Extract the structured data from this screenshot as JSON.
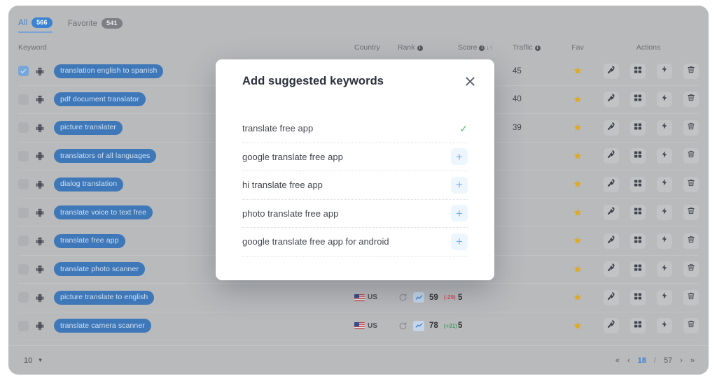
{
  "tabs": [
    {
      "label": "All",
      "count": "566",
      "active": true
    },
    {
      "label": "Favorite",
      "count": "541",
      "active": false
    }
  ],
  "table": {
    "headers": {
      "keyword": "Keyword",
      "country": "Country",
      "rank": "Rank",
      "score": "Score",
      "traffic": "Traffic",
      "fav": "Fav",
      "actions": "Actions"
    },
    "sort_icon": "sort-ascending-descending-icon",
    "rows": [
      {
        "checked": true,
        "keyword": "translation english to spanish",
        "country": "",
        "country_code": "",
        "rank": "",
        "rank_delta": "",
        "rank_delta_dir": "",
        "score": "",
        "traffic": "45",
        "fav": "★"
      },
      {
        "checked": false,
        "keyword": "pdf document translator",
        "country": "",
        "country_code": "",
        "rank": "",
        "rank_delta": "",
        "rank_delta_dir": "",
        "score": "",
        "traffic": "40",
        "fav": "★"
      },
      {
        "checked": false,
        "keyword": "picture translater",
        "country": "",
        "country_code": "",
        "rank": "",
        "rank_delta": "",
        "rank_delta_dir": "",
        "score": "",
        "traffic": "39",
        "fav": "★"
      },
      {
        "checked": false,
        "keyword": "translators of all languages",
        "country": "",
        "country_code": "",
        "rank": "",
        "rank_delta": "",
        "rank_delta_dir": "",
        "score": "",
        "traffic": "",
        "fav": "★"
      },
      {
        "checked": false,
        "keyword": "dialog translation",
        "country": "",
        "country_code": "",
        "rank": "",
        "rank_delta": "",
        "rank_delta_dir": "",
        "score": "",
        "traffic": "",
        "fav": "★"
      },
      {
        "checked": false,
        "keyword": "translate voice to text free",
        "country": "",
        "country_code": "",
        "rank": "",
        "rank_delta": "",
        "rank_delta_dir": "",
        "score": "",
        "traffic": "",
        "fav": "★"
      },
      {
        "checked": false,
        "keyword": "translate free app",
        "country": "",
        "country_code": "",
        "rank": "",
        "rank_delta": "",
        "rank_delta_dir": "",
        "score": "",
        "traffic": "",
        "fav": "★"
      },
      {
        "checked": false,
        "keyword": "translate photo scanner",
        "country": "",
        "country_code": "",
        "rank": "",
        "rank_delta": "",
        "rank_delta_dir": "",
        "score": "",
        "traffic": "",
        "fav": "★"
      },
      {
        "checked": false,
        "keyword": "picture translate to english",
        "country": "US",
        "country_code": "us-flag-icon",
        "rank": "59",
        "rank_delta": "(-29)",
        "rank_delta_dir": "neg",
        "score": "5",
        "traffic": "",
        "fav": "★"
      },
      {
        "checked": false,
        "keyword": "translate camera scanner",
        "country": "US",
        "country_code": "us-flag-icon",
        "rank": "78",
        "rank_delta": "(+31)",
        "rank_delta_dir": "pos",
        "score": "5",
        "traffic": "",
        "fav": "★"
      }
    ],
    "row_actions": [
      {
        "name": "rocket-icon",
        "title": "Boost"
      },
      {
        "name": "grid-icon",
        "title": "Grid"
      },
      {
        "name": "lightning-icon",
        "title": "Quick action"
      },
      {
        "name": "trash-icon",
        "title": "Delete"
      }
    ]
  },
  "footer": {
    "per_page": "10",
    "per_page_caret": "▾",
    "first": "«",
    "prev": "‹",
    "current_page": "18",
    "separator": "/",
    "total_pages": "57",
    "next": "›",
    "last": "»"
  },
  "modal": {
    "title": "Add suggested keywords",
    "close_icon": "close-icon",
    "items": [
      {
        "text": "translate free app",
        "state": "added",
        "glyph": "✓"
      },
      {
        "text": "google translate free app",
        "state": "addable",
        "glyph": "+"
      },
      {
        "text": "hi translate free app",
        "state": "addable",
        "glyph": "+"
      },
      {
        "text": "photo translate free app",
        "state": "addable",
        "glyph": "+"
      },
      {
        "text": "google translate free app for android",
        "state": "addable",
        "glyph": "+"
      }
    ]
  },
  "colors": {
    "accent_blue": "#3a82d2",
    "chip_blue": "#3f78b8",
    "star_gold": "#dfa920",
    "delta_negative": "#d4525f",
    "delta_positive": "#4aa06a",
    "check_green": "#53bd7e",
    "plus_blue": "#73b2ee"
  }
}
